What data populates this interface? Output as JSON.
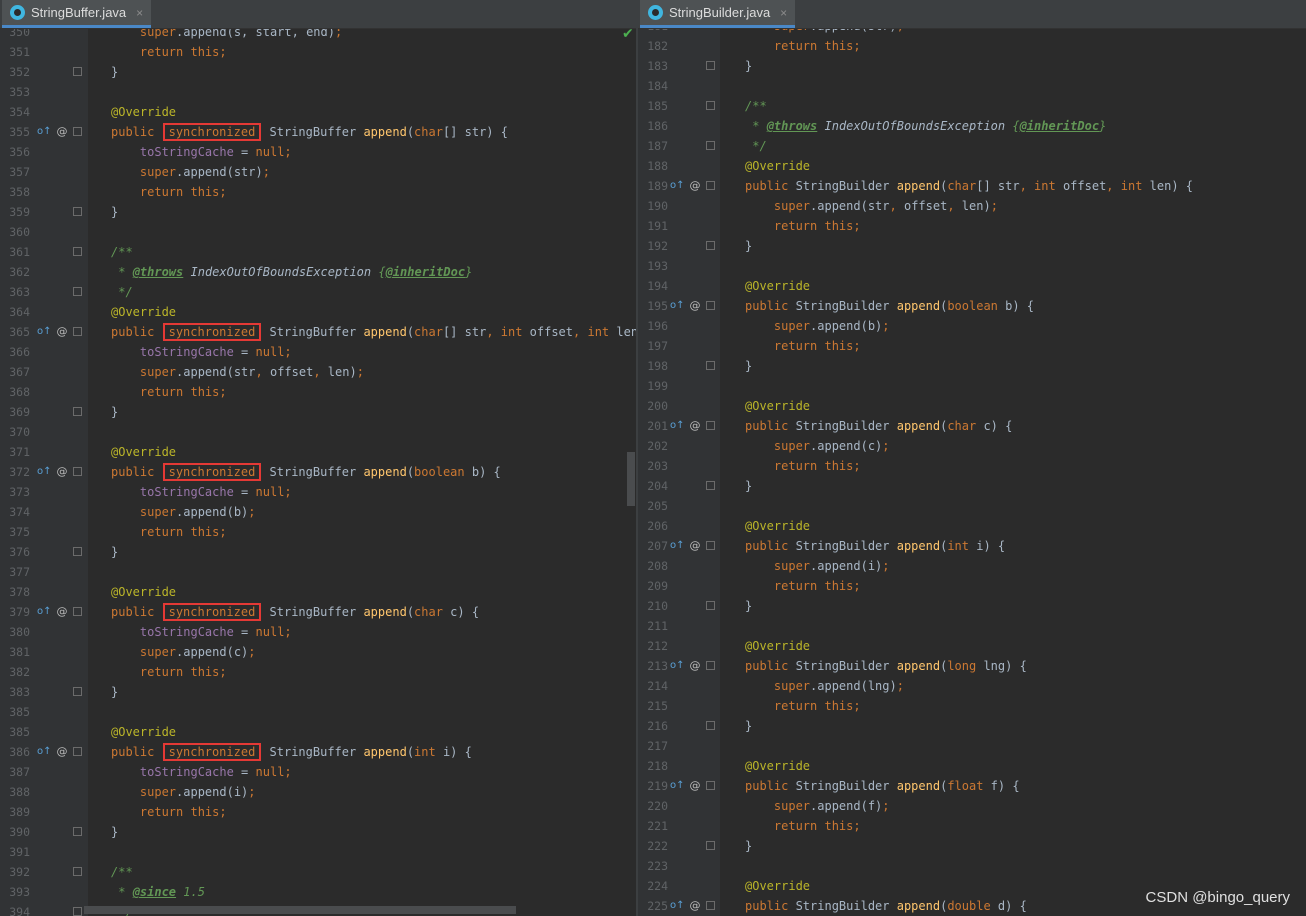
{
  "left": {
    "tab": {
      "title": "StringBuffer.java",
      "close": "×"
    },
    "lines": [
      {
        "n": "350",
        "html": "    <span class=\"kw\">super</span>.append(s, start, end)<span class=\"kw\">;</span>"
      },
      {
        "n": "351",
        "html": "    <span class=\"kw\">return this;</span>"
      },
      {
        "n": "352",
        "html": "}"
      },
      {
        "n": "353",
        "html": ""
      },
      {
        "n": "354",
        "html": "<span class=\"an\">@Override</span>"
      },
      {
        "n": "355",
        "html": "<span class=\"kw\">public</span> <span class=\"hl kw\">synchronized</span> StringBuffer <span class=\"fn\">append</span>(<span class=\"kw\">char</span>[] str) {",
        "mark": true
      },
      {
        "n": "356",
        "html": "    <span class=\"fl\">toStringCache</span> = <span class=\"kw\">null;</span>"
      },
      {
        "n": "357",
        "html": "    <span class=\"kw\">super</span>.append(str)<span class=\"kw\">;</span>"
      },
      {
        "n": "358",
        "html": "    <span class=\"kw\">return this;</span>"
      },
      {
        "n": "359",
        "html": "}"
      },
      {
        "n": "360",
        "html": ""
      },
      {
        "n": "361",
        "html": "<span class=\"dc\">/**</span>"
      },
      {
        "n": "362",
        "html": "<span class=\"dc\"> * </span><span class=\"dt\">@throws</span><span class=\"dc\"> </span><span class=\"pl\" style=\"font-style:italic\">IndexOutOfBoundsException</span><span class=\"dc\"> {</span><span class=\"dt\">@inheritDoc</span><span class=\"dc\">}</span>"
      },
      {
        "n": "363",
        "html": "<span class=\"dc\"> */</span>"
      },
      {
        "n": "364",
        "html": "<span class=\"an\">@Override</span>"
      },
      {
        "n": "365",
        "html": "<span class=\"kw\">public</span> <span class=\"hl kw\">synchronized</span> StringBuffer <span class=\"fn\">append</span>(<span class=\"kw\">char</span>[] str<span class=\"kw\">, int</span> offset<span class=\"kw\">, int</span> len) {",
        "mark": true
      },
      {
        "n": "366",
        "html": "    <span class=\"fl\">toStringCache</span> = <span class=\"kw\">null;</span>"
      },
      {
        "n": "367",
        "html": "    <span class=\"kw\">super</span>.append(str<span class=\"kw\">,</span> offset<span class=\"kw\">,</span> len)<span class=\"kw\">;</span>"
      },
      {
        "n": "368",
        "html": "    <span class=\"kw\">return this;</span>"
      },
      {
        "n": "369",
        "html": "}"
      },
      {
        "n": "370",
        "html": ""
      },
      {
        "n": "371",
        "html": "<span class=\"an\">@Override</span>"
      },
      {
        "n": "372",
        "html": "<span class=\"kw\">public</span> <span class=\"hl kw\">synchronized</span> StringBuffer <span class=\"fn\">append</span>(<span class=\"kw\">boolean</span> b) {",
        "mark": true
      },
      {
        "n": "373",
        "html": "    <span class=\"fl\">toStringCache</span> = <span class=\"kw\">null;</span>"
      },
      {
        "n": "374",
        "html": "    <span class=\"kw\">super</span>.append(b)<span class=\"kw\">;</span>"
      },
      {
        "n": "375",
        "html": "    <span class=\"kw\">return this;</span>"
      },
      {
        "n": "376",
        "html": "}"
      },
      {
        "n": "377",
        "html": ""
      },
      {
        "n": "378",
        "html": "<span class=\"an\">@Override</span>"
      },
      {
        "n": "379",
        "html": "<span class=\"kw\">public</span> <span class=\"hl kw\">synchronized</span> StringBuffer <span class=\"fn\">append</span>(<span class=\"kw\">char</span> c) {",
        "mark": true
      },
      {
        "n": "380",
        "html": "    <span class=\"fl\">toStringCache</span> = <span class=\"kw\">null;</span>"
      },
      {
        "n": "381",
        "html": "    <span class=\"kw\">super</span>.append(c)<span class=\"kw\">;</span>"
      },
      {
        "n": "382",
        "html": "    <span class=\"kw\">return this;</span>"
      },
      {
        "n": "383",
        "html": "}"
      },
      {
        "n": "385",
        "html": ""
      },
      {
        "n": "385",
        "html": "<span class=\"an\">@Override</span>"
      },
      {
        "n": "386",
        "html": "<span class=\"kw\">public</span> <span class=\"hl kw\">synchronized</span> StringBuffer <span class=\"fn\">append</span>(<span class=\"kw\">int</span> i) {",
        "mark": true
      },
      {
        "n": "387",
        "html": "    <span class=\"fl\">toStringCache</span> = <span class=\"kw\">null;</span>"
      },
      {
        "n": "388",
        "html": "    <span class=\"kw\">super</span>.append(i)<span class=\"kw\">;</span>"
      },
      {
        "n": "389",
        "html": "    <span class=\"kw\">return this;</span>"
      },
      {
        "n": "390",
        "html": "}"
      },
      {
        "n": "391",
        "html": ""
      },
      {
        "n": "392",
        "html": "<span class=\"dc\">/**</span>"
      },
      {
        "n": "393",
        "html": "<span class=\"dc\"> * </span><span class=\"dt\">@since</span><span class=\"dc\"> 1.5</span>"
      },
      {
        "n": "394",
        "html": "<span class=\"dc\"> */</span>"
      }
    ]
  },
  "right": {
    "tab": {
      "title": "StringBuilder.java",
      "close": "×"
    },
    "lines": [
      {
        "n": "181",
        "html": "    <span class=\"kw\">super</span>.append(str)<span class=\"kw\">;</span>"
      },
      {
        "n": "182",
        "html": "    <span class=\"kw\">return this;</span>"
      },
      {
        "n": "183",
        "html": "}"
      },
      {
        "n": "184",
        "html": ""
      },
      {
        "n": "185",
        "html": "<span class=\"dc\">/**</span>"
      },
      {
        "n": "186",
        "html": "<span class=\"dc\"> * </span><span class=\"dt\">@throws</span><span class=\"dc\"> </span><span class=\"pl\" style=\"font-style:italic\">IndexOutOfBoundsException</span><span class=\"dc\"> {</span><span class=\"dt\">@inheritDoc</span><span class=\"dc\">}</span>"
      },
      {
        "n": "187",
        "html": "<span class=\"dc\"> */</span>"
      },
      {
        "n": "188",
        "html": "<span class=\"an\">@Override</span>"
      },
      {
        "n": "189",
        "html": "<span class=\"kw\">public</span> StringBuilder <span class=\"fn\">append</span>(<span class=\"kw\">char</span>[] str<span class=\"kw\">, int</span> offset<span class=\"kw\">, int</span> len) {",
        "mark": true
      },
      {
        "n": "190",
        "html": "    <span class=\"kw\">super</span>.append(str<span class=\"kw\">,</span> offset<span class=\"kw\">,</span> len)<span class=\"kw\">;</span>"
      },
      {
        "n": "191",
        "html": "    <span class=\"kw\">return this;</span>"
      },
      {
        "n": "192",
        "html": "}"
      },
      {
        "n": "193",
        "html": ""
      },
      {
        "n": "194",
        "html": "<span class=\"an\">@Override</span>"
      },
      {
        "n": "195",
        "html": "<span class=\"kw\">public</span> StringBuilder <span class=\"fn\">append</span>(<span class=\"kw\">boolean</span> b) {",
        "mark": true
      },
      {
        "n": "196",
        "html": "    <span class=\"kw\">super</span>.append(b)<span class=\"kw\">;</span>"
      },
      {
        "n": "197",
        "html": "    <span class=\"kw\">return this;</span>"
      },
      {
        "n": "198",
        "html": "}"
      },
      {
        "n": "199",
        "html": ""
      },
      {
        "n": "200",
        "html": "<span class=\"an\">@Override</span>"
      },
      {
        "n": "201",
        "html": "<span class=\"kw\">public</span> StringBuilder <span class=\"fn\">append</span>(<span class=\"kw\">char</span> c) {",
        "mark": true
      },
      {
        "n": "202",
        "html": "    <span class=\"kw\">super</span>.append(c)<span class=\"kw\">;</span>"
      },
      {
        "n": "203",
        "html": "    <span class=\"kw\">return this;</span>"
      },
      {
        "n": "204",
        "html": "}"
      },
      {
        "n": "205",
        "html": ""
      },
      {
        "n": "206",
        "html": "<span class=\"an\">@Override</span>"
      },
      {
        "n": "207",
        "html": "<span class=\"kw\">public</span> StringBuilder <span class=\"fn\">append</span>(<span class=\"kw\">int</span> i) {",
        "mark": true
      },
      {
        "n": "208",
        "html": "    <span class=\"kw\">super</span>.append(i)<span class=\"kw\">;</span>"
      },
      {
        "n": "209",
        "html": "    <span class=\"kw\">return this;</span>"
      },
      {
        "n": "210",
        "html": "}"
      },
      {
        "n": "211",
        "html": ""
      },
      {
        "n": "212",
        "html": "<span class=\"an\">@Override</span>"
      },
      {
        "n": "213",
        "html": "<span class=\"kw\">public</span> StringBuilder <span class=\"fn\">append</span>(<span class=\"kw\">long</span> lng) {",
        "mark": true
      },
      {
        "n": "214",
        "html": "    <span class=\"kw\">super</span>.append(lng)<span class=\"kw\">;</span>"
      },
      {
        "n": "215",
        "html": "    <span class=\"kw\">return this;</span>"
      },
      {
        "n": "216",
        "html": "}"
      },
      {
        "n": "217",
        "html": ""
      },
      {
        "n": "218",
        "html": "<span class=\"an\">@Override</span>"
      },
      {
        "n": "219",
        "html": "<span class=\"kw\">public</span> StringBuilder <span class=\"fn\">append</span>(<span class=\"kw\">float</span> f) {",
        "mark": true
      },
      {
        "n": "220",
        "html": "    <span class=\"kw\">super</span>.append(f)<span class=\"kw\">;</span>"
      },
      {
        "n": "221",
        "html": "    <span class=\"kw\">return this;</span>"
      },
      {
        "n": "222",
        "html": "}"
      },
      {
        "n": "223",
        "html": ""
      },
      {
        "n": "224",
        "html": "<span class=\"an\">@Override</span>"
      },
      {
        "n": "225",
        "html": "<span class=\"kw\">public</span> StringBuilder <span class=\"fn\">append</span>(<span class=\"kw\">double</span> d) {",
        "mark": true
      }
    ]
  },
  "watermark": "CSDN @bingo_query",
  "gutter_marks": {
    "override": "o↑",
    "annotation": "@"
  }
}
